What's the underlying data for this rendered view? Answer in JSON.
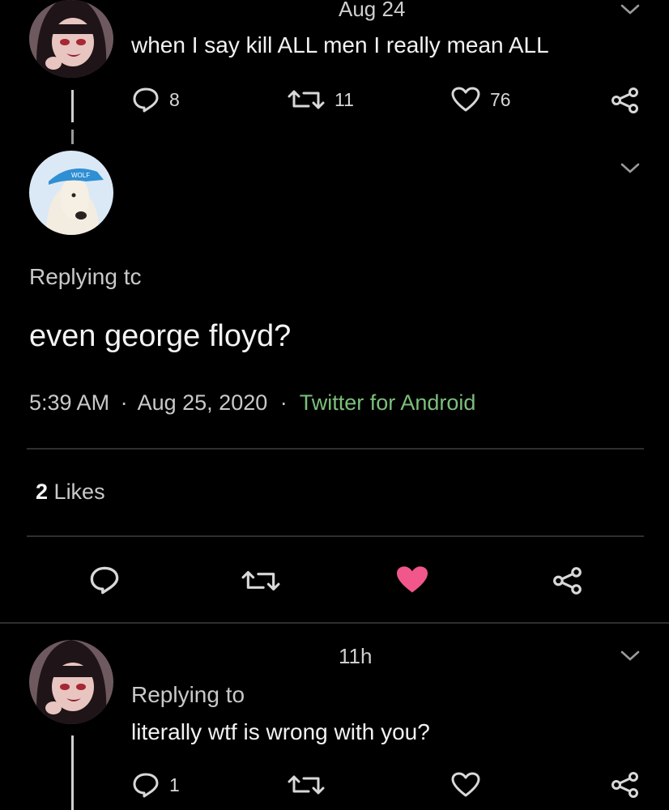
{
  "tweet1": {
    "date": "Aug 24",
    "text": "when I say kill ALL men I really mean ALL",
    "replies": "8",
    "retweets": "11",
    "likes": "76",
    "icons": [
      "reply-icon",
      "retweet-icon",
      "heart-outline-icon",
      "share-icon",
      "chevron-down-icon"
    ]
  },
  "main": {
    "replying_label": "Replying tc",
    "text": "even george floyd?",
    "time": "5:39 AM",
    "date": "Aug 25, 2020",
    "separator": "·",
    "source": "Twitter for Android",
    "likes_count": "2",
    "likes_label": "Likes",
    "liked": true,
    "like_color": "#f1578b",
    "source_color": "#7bbf7a",
    "avatar_cap_text": "WOLF"
  },
  "reply": {
    "time": "11h",
    "replying_label": "Replying to",
    "text": "literally wtf is wrong with you?",
    "replies": "1"
  }
}
